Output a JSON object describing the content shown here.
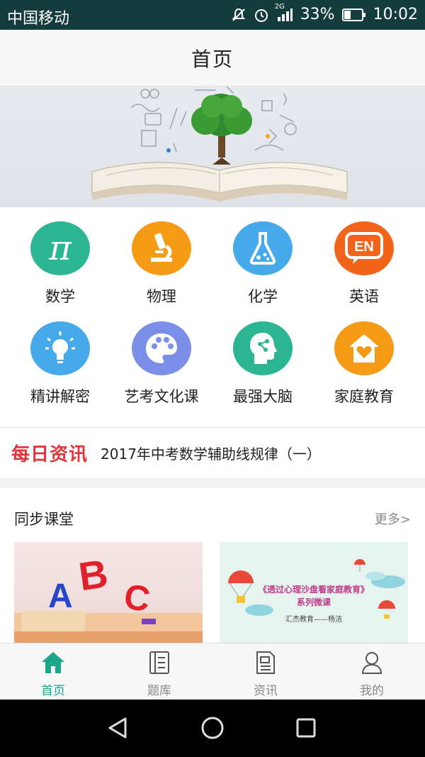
{
  "status_bar": {
    "carrier": "中国移动",
    "network": "2G",
    "battery": "33%",
    "time": "10:02",
    "icons": [
      "mute-icon",
      "alarm-icon",
      "signal-icon",
      "battery-icon"
    ]
  },
  "header": {
    "title": "首页"
  },
  "banner": {
    "image": "open-book-with-tree-illustration"
  },
  "categories": [
    {
      "label": "数学",
      "icon": "pi-icon",
      "color": "#2bb591"
    },
    {
      "label": "物理",
      "icon": "microscope-icon",
      "color": "#f59a14"
    },
    {
      "label": "化学",
      "icon": "flask-icon",
      "color": "#46a9ea"
    },
    {
      "label": "英语",
      "icon": "en-bubble-icon",
      "color": "#f2641a"
    },
    {
      "label": "精讲解密",
      "icon": "lightbulb-icon",
      "color": "#46a9ea"
    },
    {
      "label": "艺考文化课",
      "icon": "palette-icon",
      "color": "#7b8fe8"
    },
    {
      "label": "最强大脑",
      "icon": "brain-head-icon",
      "color": "#2bb591"
    },
    {
      "label": "家庭教育",
      "icon": "home-heart-icon",
      "color": "#f59a14"
    }
  ],
  "news": {
    "badge": "每日资讯",
    "headline": "2017年中考数学辅助线规律（一）"
  },
  "section": {
    "title": "同步课堂",
    "more": "更多>",
    "cards": [
      {
        "image": "abc-letters-photo"
      },
      {
        "title": "《透过心理沙盘看家庭教育》",
        "subtitle": "系列微课",
        "footer": "汇杰教育——杨洁"
      }
    ]
  },
  "tabbar": {
    "items": [
      {
        "label": "首页",
        "icon": "home-icon",
        "active": true
      },
      {
        "label": "题库",
        "icon": "notebook-icon",
        "active": false
      },
      {
        "label": "资讯",
        "icon": "document-icon",
        "active": false
      },
      {
        "label": "我的",
        "icon": "user-icon",
        "active": false
      }
    ]
  },
  "colors": {
    "accent": "#1aa68a",
    "status_bar": "#143c3c",
    "news_badge": "#e2363f"
  }
}
